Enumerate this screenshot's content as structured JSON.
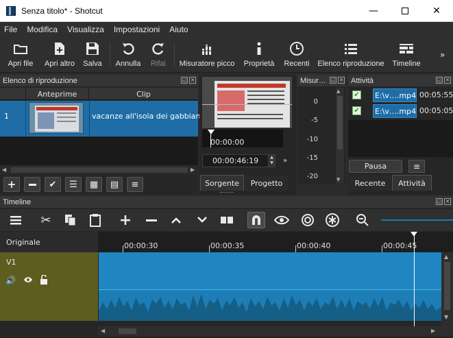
{
  "window": {
    "title": "Senza titolo* - Shotcut"
  },
  "menu": [
    "File",
    "Modifica",
    "Visualizza",
    "Impostazioni",
    "Aiuto"
  ],
  "toolbar": {
    "open_file": "Apri file",
    "open_other": "Apri altro",
    "save": "Salva",
    "undo": "Annulla",
    "redo": "Rifai",
    "peak_meter": "Misuratore picco",
    "properties": "Proprietà",
    "recent": "Recenti",
    "playlist": "Elenco riproduzione",
    "timeline": "Timeline",
    "more": "»"
  },
  "playlist": {
    "title": "Elenco di riproduzione",
    "columns": [
      "Anteprime",
      "Clip"
    ],
    "rows": [
      {
        "num": "1",
        "clip": "vacanze all'isola dei gabbiani"
      }
    ]
  },
  "viewer": {
    "timecode_position": "00:00:00",
    "timecode_duration": "00:00:46:19",
    "ff": "»",
    "tabs": [
      "Sorgente",
      "Progetto"
    ]
  },
  "meter": {
    "title": "Misur…",
    "scale": [
      "0",
      "-5",
      "-10",
      "-15",
      "-20"
    ]
  },
  "jobs": {
    "title": "Attività",
    "items": [
      {
        "name": "E:\\v….mp4",
        "time": "00:05:55"
      },
      {
        "name": "E:\\v….mp4",
        "time": "00:05:05"
      }
    ],
    "pause": "Pausa",
    "tabs": [
      "Recente",
      "Attività"
    ]
  },
  "timeline": {
    "title": "Timeline",
    "header_label": "Originale",
    "track_name": "V1",
    "ruler": [
      "00:00:30",
      "00:00:35",
      "00:00:40",
      "00:00:45"
    ]
  },
  "colors": {
    "accent": "#1e6da6",
    "clip": "#1d7db6",
    "track": "#5d5d20",
    "background": "#262626"
  }
}
